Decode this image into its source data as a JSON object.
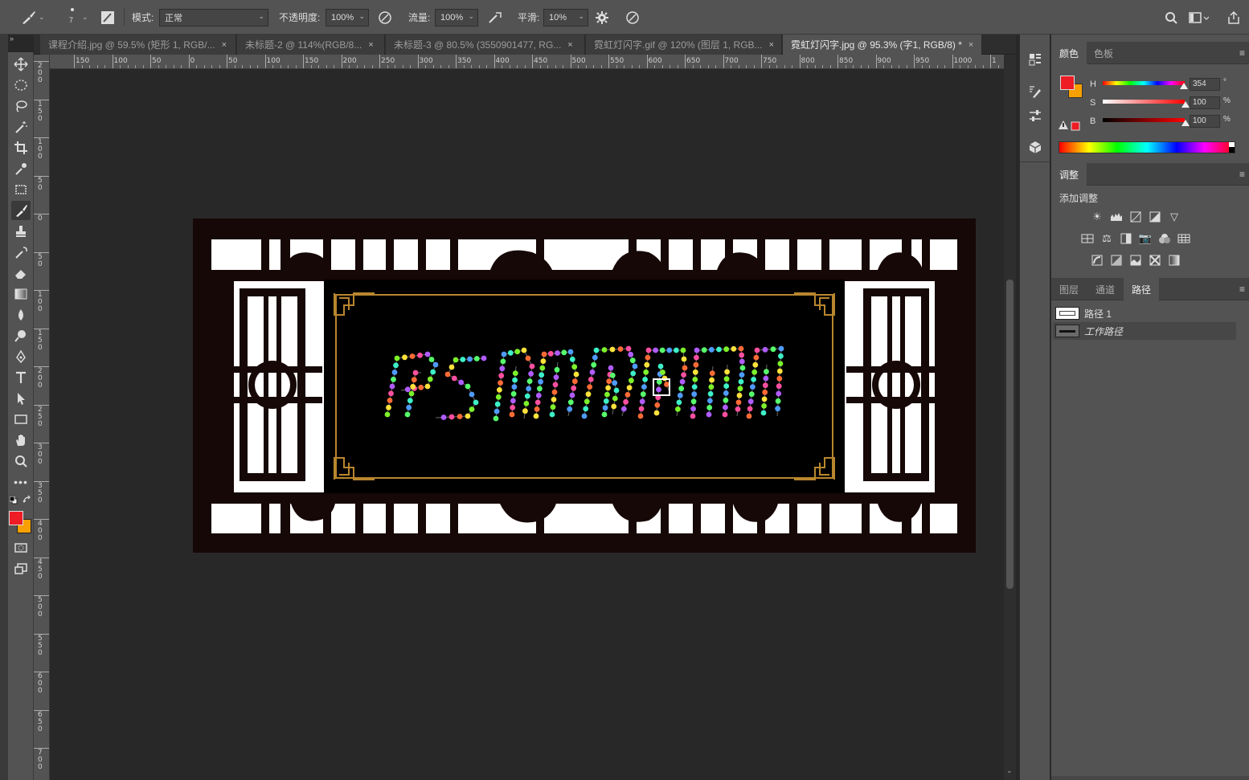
{
  "options_bar": {
    "brush_size": "7",
    "mode_label": "模式:",
    "mode_value": "正常",
    "opacity_label": "不透明度:",
    "opacity_value": "100%",
    "flow_label": "流量:",
    "flow_value": "100%",
    "smoothing_label": "平滑:",
    "smoothing_value": "10%"
  },
  "tabs": [
    {
      "label": "课程介绍.jpg @ 59.5% (矩形 1, RGB/...",
      "close": "×",
      "active": false
    },
    {
      "label": "未标题-2 @ 114%(RGB/8...",
      "close": "×",
      "active": false
    },
    {
      "label": "未标题-3 @ 80.5% (3550901477, RG...",
      "close": "×",
      "active": false
    },
    {
      "label": "霓虹灯闪字.gif @ 120% (图层 1, RGB...",
      "close": "×",
      "active": false
    },
    {
      "label": "霓虹灯闪字.jpg @ 95.3% (字1, RGB/8) *",
      "close": "×",
      "active": true
    }
  ],
  "ruler": {
    "h_ticks": [
      "150",
      "100",
      "50",
      "0",
      "50",
      "100",
      "150",
      "200",
      "250",
      "300",
      "350",
      "400",
      "450",
      "500",
      "550",
      "600",
      "650",
      "700",
      "750",
      "800",
      "850",
      "900",
      "950",
      "1000",
      "1"
    ],
    "v_ticks": [
      "2 0 0",
      "1 5 0",
      "1 0 0",
      "5 0",
      "0",
      "5 0",
      "1 0 0",
      "1 5 0",
      "2 0 0",
      "2 5 0",
      "3 0 0",
      "3 5 0",
      "4 0 0",
      "4 5 0",
      "5 0 0",
      "5 5 0",
      "6 0 0",
      "6 5 0",
      "7 0 0"
    ]
  },
  "canvas": {
    "artwork_text": "PS闪动动画",
    "frame_color": "#1a0a08",
    "gold_border_color": "#b8862e",
    "light_colors": [
      "#7cf22a",
      "#ff4fa0",
      "#4f9bff",
      "#ffe23b",
      "#b05cff",
      "#3df0c8",
      "#ff6b35",
      "#56ff6b"
    ]
  },
  "colors": {
    "foreground": "#ee1c24",
    "background": "#f7a000",
    "accent_tab": "#535353"
  },
  "color_panel": {
    "tabs": [
      "颜色",
      "色板"
    ],
    "h_label": "H",
    "h_value": "354",
    "h_unit": "°",
    "s_label": "S",
    "s_value": "100",
    "s_unit": "%",
    "b_label": "B",
    "b_value": "100",
    "b_unit": "%"
  },
  "adjust_panel": {
    "tab": "调整",
    "add_label": "添加调整"
  },
  "layers_panel": {
    "tabs": [
      "图层",
      "通道",
      "路径"
    ],
    "paths": [
      "路径 1",
      "工作路径"
    ]
  }
}
